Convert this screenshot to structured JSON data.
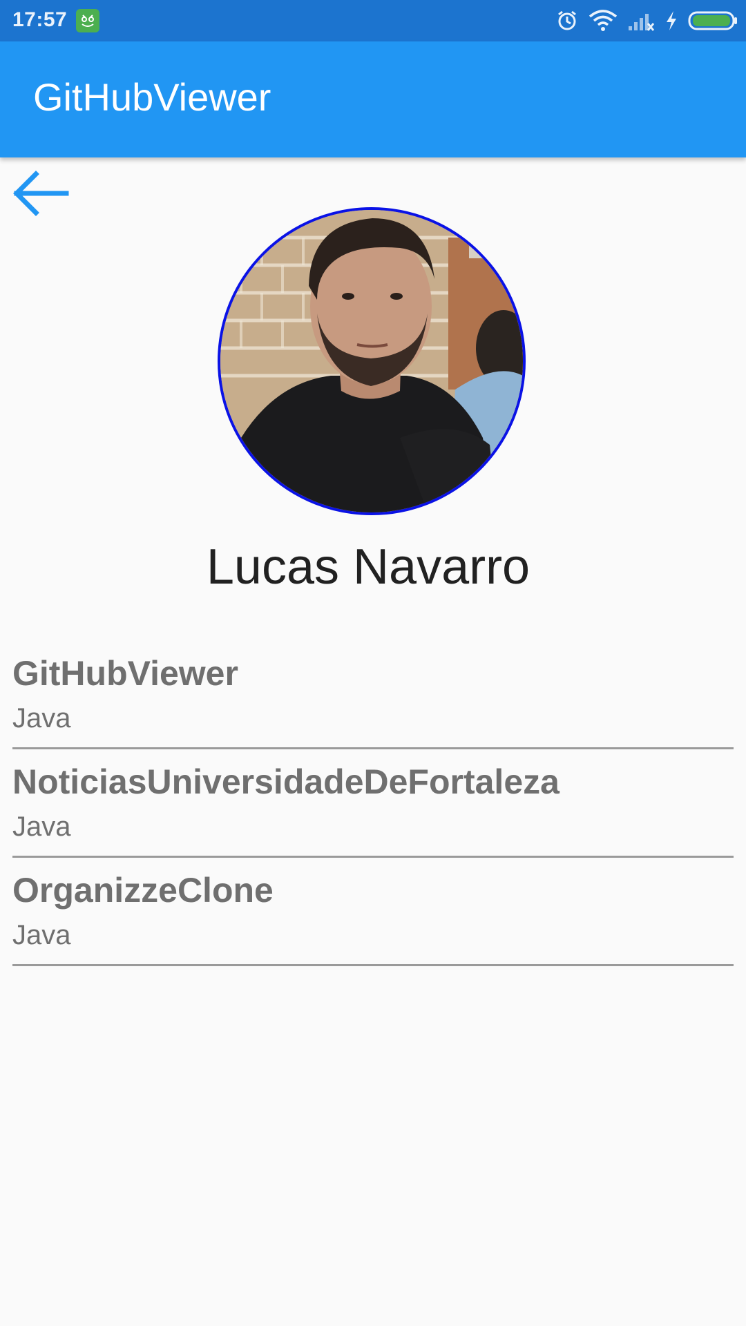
{
  "status_bar": {
    "time": "17:57",
    "icons": [
      "app-notification-icon",
      "alarm-icon",
      "wifi-icon",
      "signal-icon",
      "charging-icon",
      "battery-icon"
    ],
    "colors": {
      "background": "#1c74cf",
      "battery": "#4caf50"
    }
  },
  "app_bar": {
    "title": "GitHubViewer",
    "color": "#2196f3"
  },
  "navigation": {
    "back_icon": "arrow-left-icon",
    "back_icon_color": "#2196f3"
  },
  "profile": {
    "name": "Lucas Navarro",
    "avatar_border_color": "#0a12e6"
  },
  "repositories": [
    {
      "name": "GitHubViewer",
      "language": "Java"
    },
    {
      "name": "NoticiasUniversidadeDeFortaleza",
      "language": "Java"
    },
    {
      "name": "OrganizzeClone",
      "language": "Java"
    }
  ]
}
